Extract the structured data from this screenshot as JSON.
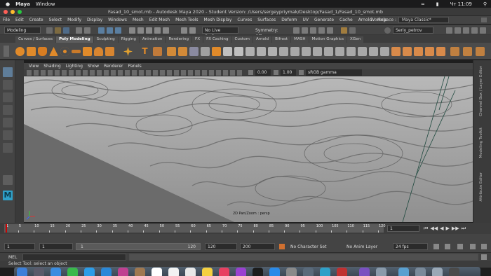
{
  "mac_menubar": {
    "app": "Maya",
    "items": [
      "Window"
    ],
    "clock": "Чт 11:09"
  },
  "window": {
    "title": "Fasad_10_smot.mb - Autodesk Maya 2020 - Student Version: /Users/sergeypriymak/Desktop/Fasad_1/Fasad_10_smot.mb"
  },
  "menus": [
    "File",
    "Edit",
    "Create",
    "Select",
    "Modify",
    "Display",
    "Windows",
    "Mesh",
    "Edit Mesh",
    "Mesh Tools",
    "Mesh Display",
    "Curves",
    "Surfaces",
    "Deform",
    "UV",
    "Generate",
    "Cache",
    "Arnold",
    "Help"
  ],
  "workspace": {
    "label": "Workspace :",
    "value": "Maya Classic*"
  },
  "status_line": {
    "mode": "Modeling",
    "live_surface": "No Live Surface",
    "symmetry": "Symmetry: Off",
    "user": "Seriy_petrov"
  },
  "shelf_tabs": [
    "Curves / Surfaces",
    "Poly Modeling",
    "Sculpting",
    "Rigging",
    "Animation",
    "Rendering",
    "FX",
    "FX Caching",
    "Custom",
    "Arnold",
    "Bifrost",
    "MASH",
    "Motion Graphics",
    "XGen"
  ],
  "shelf_active": "Poly Modeling",
  "panel_menus": [
    "View",
    "Shading",
    "Lighting",
    "Show",
    "Renderer",
    "Panels"
  ],
  "panel_toolbar": {
    "exposure": "0.00",
    "gamma": "1.00",
    "color_space": "sRGB gamma"
  },
  "viewport": {
    "caption": "2D Pan/Zoom : persp"
  },
  "side_tabs": [
    "Channel Box / Layer Editor",
    "Modeling Toolkit",
    "Attribute Editor"
  ],
  "timeline": {
    "ticks": [
      "1",
      "5",
      "10",
      "15",
      "20",
      "25",
      "30",
      "35",
      "40",
      "45",
      "50",
      "55",
      "60",
      "65",
      "70",
      "75",
      "80",
      "85",
      "90",
      "95",
      "100",
      "105",
      "110",
      "115",
      "120"
    ],
    "current_frame": "1"
  },
  "range": {
    "start": "1",
    "start2": "1",
    "slider_start": "1",
    "slider_end": "120",
    "end": "120",
    "end2": "200",
    "character_set": "No Character Set",
    "anim_layer": "No Anim Layer",
    "fps": "24 fps"
  },
  "command_line": {
    "lang": "MEL"
  },
  "help_line": "Select Tool: select an object",
  "colors": {
    "maya_accent": "#2fa0c8",
    "shelf_orange": "#e08a2a",
    "viewport_bg": "#6c6c6c"
  }
}
